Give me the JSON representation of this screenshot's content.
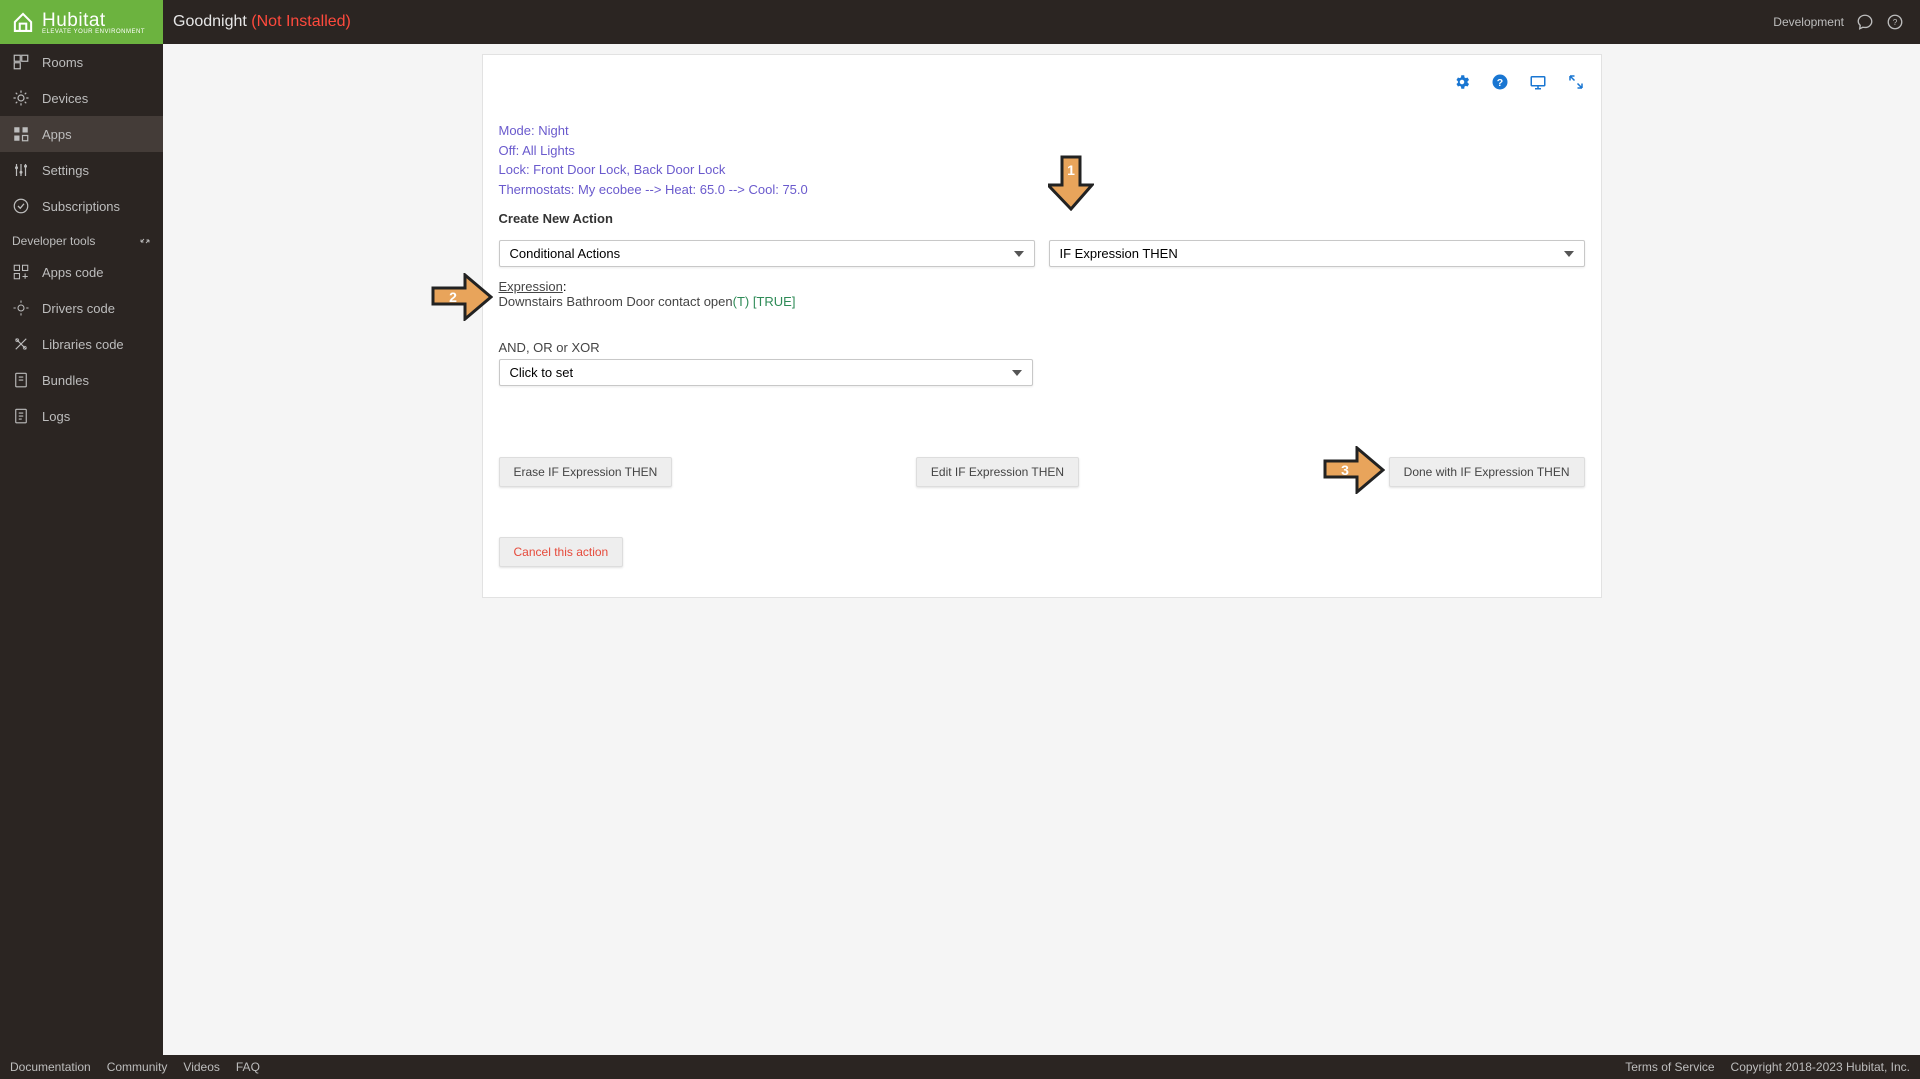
{
  "header": {
    "title": "Goodnight ",
    "status": "(Not Installed)",
    "env": "Development",
    "logo_text": "Hubitat",
    "logo_sub": "ELEVATE YOUR ENVIRONMENT"
  },
  "sidebar": {
    "items": [
      "Rooms",
      "Devices",
      "Apps",
      "Settings",
      "Subscriptions"
    ],
    "dev_label": "Developer tools",
    "dev_items": [
      "Apps code",
      "Drivers code",
      "Libraries code",
      "Bundles",
      "Logs"
    ]
  },
  "summary": {
    "l1": "Mode: Night",
    "l2": "Off: All Lights",
    "l3": "Lock: Front Door Lock, Back Door Lock",
    "l4": "Thermostats: My ecobee --> Heat: 65.0 --> Cool: 75.0"
  },
  "form": {
    "section": "Create New Action",
    "sel1": "Conditional Actions",
    "sel2": "IF Expression THEN",
    "expr_label": "Expression",
    "expr_text": "Downstairs Bathroom Door contact open",
    "expr_tf": "(T) [TRUE]",
    "and_label": "AND, OR or XOR",
    "and_value": "Click to set",
    "btn_erase": "Erase IF Expression THEN",
    "btn_edit": "Edit IF Expression THEN",
    "btn_done": "Done with IF Expression THEN",
    "btn_cancel": "Cancel this action"
  },
  "arrows": {
    "a1": "1",
    "a2": "2",
    "a3": "3"
  },
  "footer": {
    "links": [
      "Documentation",
      "Community",
      "Videos",
      "FAQ"
    ],
    "terms": "Terms of Service",
    "copy": "Copyright 2018-2023 Hubitat, Inc."
  }
}
